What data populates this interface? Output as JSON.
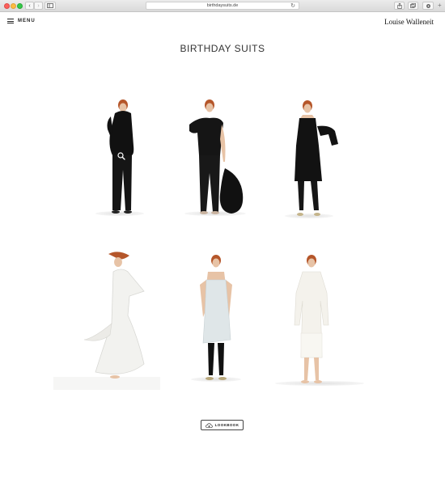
{
  "browser": {
    "url": "birthdaysuits.de",
    "back_glyph": "‹",
    "forward_glyph": "›",
    "reload_glyph": "↻",
    "new_tab_glyph": "+"
  },
  "header": {
    "menu_label": "MENU",
    "brand": "Louise Walleneit"
  },
  "page": {
    "title": "BIRTHDAY SUITS"
  },
  "gallery": {
    "items": [
      {
        "outfit": "black hooded top and trousers",
        "color": "#111111"
      },
      {
        "outfit": "black asymmetric top, trousers and bag",
        "color": "#151515"
      },
      {
        "outfit": "black halter dress with leggings",
        "color": "#121212"
      },
      {
        "outfit": "white draped asymmetric dress",
        "color": "#f2f2ef"
      },
      {
        "outfit": "pale blue slip dress with black tights",
        "color": "#dfe6e8"
      },
      {
        "outfit": "white long-sleeve knit dress",
        "color": "#f4f2ec"
      }
    ],
    "skin_color": "#e7c3a6",
    "hair_color": "#b5562a"
  },
  "lookbook": {
    "label": "LOOKBOOK",
    "icon": "cloud-download-icon"
  }
}
